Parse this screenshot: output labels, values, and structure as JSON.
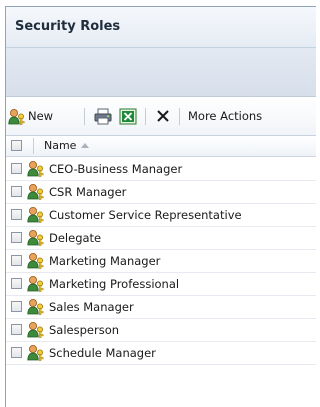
{
  "panel": {
    "title": "Security Roles"
  },
  "toolbar": {
    "new_label": "New",
    "more_actions_label": "More Actions"
  },
  "grid": {
    "name_column_header": "Name",
    "rows": [
      {
        "label": "CEO-Business Manager"
      },
      {
        "label": "CSR Manager"
      },
      {
        "label": "Customer Service Representative"
      },
      {
        "label": "Delegate"
      },
      {
        "label": "Marketing Manager"
      },
      {
        "label": "Marketing Professional"
      },
      {
        "label": "Sales Manager"
      },
      {
        "label": "Salesperson"
      },
      {
        "label": "Schedule Manager"
      }
    ]
  },
  "icons": {
    "new": "user-role-icon",
    "print": "printer-icon",
    "export": "excel-icon",
    "delete": "close-icon",
    "row": "user-role-icon"
  }
}
